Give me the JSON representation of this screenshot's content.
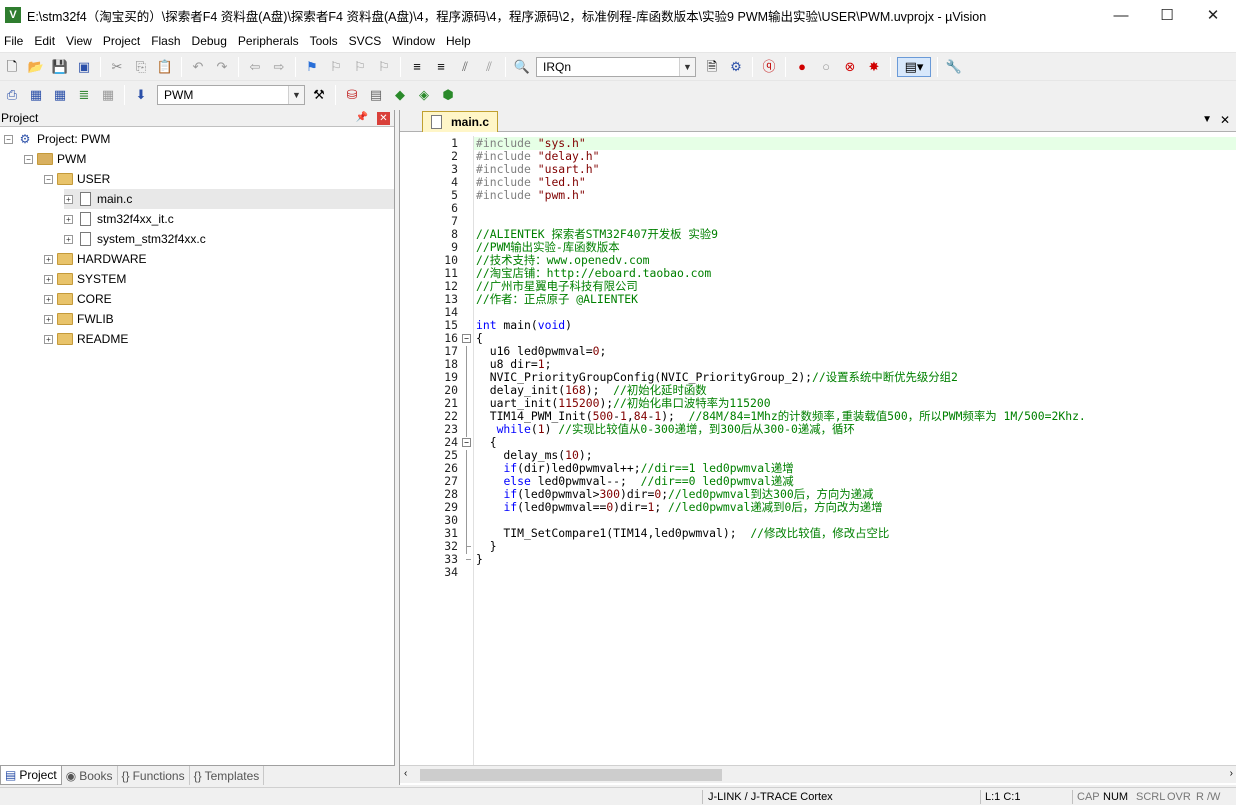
{
  "window": {
    "title": "E:\\stm32f4（淘宝买的）\\探索者F4 资料盘(A盘)\\探索者F4 资料盘(A盘)\\4，程序源码\\4，程序源码\\2，标准例程-库函数版本\\实验9 PWM输出实验\\USER\\PWM.uvprojx - µVision",
    "app_icon": "V",
    "controls": {
      "minimize": "—",
      "maximize": "☐",
      "close": "✕"
    }
  },
  "menu": [
    "File",
    "Edit",
    "View",
    "Project",
    "Flash",
    "Debug",
    "Peripherals",
    "Tools",
    "SVCS",
    "Window",
    "Help"
  ],
  "toolbar1": {
    "find_combo": "IRQn"
  },
  "toolbar2": {
    "target_combo": "PWM"
  },
  "project_pane": {
    "title": "Project",
    "pin": "📌",
    "close": "✕",
    "tree": [
      {
        "label": "Project: PWM",
        "level": 0,
        "expander": "−",
        "type": "project"
      },
      {
        "label": "PWM",
        "level": 1,
        "expander": "−",
        "type": "target"
      },
      {
        "label": "USER",
        "level": 2,
        "expander": "−",
        "type": "folder"
      },
      {
        "label": "main.c",
        "level": 3,
        "expander": "+",
        "type": "file",
        "selected": true
      },
      {
        "label": "stm32f4xx_it.c",
        "level": 3,
        "expander": "+",
        "type": "file"
      },
      {
        "label": "system_stm32f4xx.c",
        "level": 3,
        "expander": "+",
        "type": "file"
      },
      {
        "label": "HARDWARE",
        "level": 2,
        "expander": "+",
        "type": "folder"
      },
      {
        "label": "SYSTEM",
        "level": 2,
        "expander": "+",
        "type": "folder"
      },
      {
        "label": "CORE",
        "level": 2,
        "expander": "+",
        "type": "folder"
      },
      {
        "label": "FWLIB",
        "level": 2,
        "expander": "+",
        "type": "folder"
      },
      {
        "label": "README",
        "level": 2,
        "expander": "+",
        "type": "folder"
      }
    ],
    "tabs": [
      {
        "label": "Project",
        "icon": "▤",
        "active": true
      },
      {
        "label": "Books",
        "icon": "◉",
        "active": false
      },
      {
        "label": "Functions",
        "icon": "{}",
        "active": false
      },
      {
        "label": "Templates",
        "icon": "{}",
        "active": false
      }
    ]
  },
  "editor": {
    "tab": "main.c",
    "dropdown": "▼",
    "close": "✕",
    "lines": [
      [
        [
          "pp",
          "#include "
        ],
        [
          "str",
          "\"sys.h\""
        ]
      ],
      [
        [
          "pp",
          "#include "
        ],
        [
          "str",
          "\"delay.h\""
        ]
      ],
      [
        [
          "pp",
          "#include "
        ],
        [
          "str",
          "\"usart.h\""
        ]
      ],
      [
        [
          "pp",
          "#include "
        ],
        [
          "str",
          "\"led.h\""
        ]
      ],
      [
        [
          "pp",
          "#include "
        ],
        [
          "str",
          "\"pwm.h\""
        ]
      ],
      [],
      [],
      [
        [
          "cm",
          "//ALIENTEK 探索者STM32F407开发板 实验9"
        ]
      ],
      [
        [
          "cm",
          "//PWM输出实验-库函数版本"
        ]
      ],
      [
        [
          "cm",
          "//技术支持：www.openedv.com"
        ]
      ],
      [
        [
          "cm",
          "//淘宝店铺：http://eboard.taobao.com"
        ]
      ],
      [
        [
          "cm",
          "//广州市星翼电子科技有限公司"
        ]
      ],
      [
        [
          "cm",
          "//作者：正点原子 @ALIENTEK"
        ]
      ],
      [],
      [
        [
          "kw",
          "int"
        ],
        [
          "tx",
          " main("
        ],
        [
          "kw",
          "void"
        ],
        [
          "tx",
          ")"
        ]
      ],
      [
        [
          "tx",
          "{"
        ]
      ],
      [
        [
          "tx",
          "  u16 led0pwmval="
        ],
        [
          "num",
          "0"
        ],
        [
          "tx",
          ";"
        ]
      ],
      [
        [
          "tx",
          "  u8 dir="
        ],
        [
          "num",
          "1"
        ],
        [
          "tx",
          ";"
        ]
      ],
      [
        [
          "tx",
          "  NVIC_PriorityGroupConfig(NVIC_PriorityGroup_2);"
        ],
        [
          "cm",
          "//设置系统中断优先级分组2"
        ]
      ],
      [
        [
          "tx",
          "  delay_init("
        ],
        [
          "num",
          "168"
        ],
        [
          "tx",
          ");  "
        ],
        [
          "cm",
          "//初始化延时函数"
        ]
      ],
      [
        [
          "tx",
          "  uart_init("
        ],
        [
          "num",
          "115200"
        ],
        [
          "tx",
          ");"
        ],
        [
          "cm",
          "//初始化串口波特率为115200"
        ]
      ],
      [
        [
          "tx",
          "  TIM14_PWM_Init("
        ],
        [
          "num",
          "500"
        ],
        [
          "tx",
          "-"
        ],
        [
          "num",
          "1"
        ],
        [
          "tx",
          ","
        ],
        [
          "num",
          "84"
        ],
        [
          "tx",
          "-"
        ],
        [
          "num",
          "1"
        ],
        [
          "tx",
          ");  "
        ],
        [
          "cm",
          "//84M/84=1Mhz的计数频率,重装载值500，所以PWM频率为 1M/500=2Khz."
        ]
      ],
      [
        [
          "tx",
          "   "
        ],
        [
          "kw",
          "while"
        ],
        [
          "tx",
          "("
        ],
        [
          "num",
          "1"
        ],
        [
          "tx",
          ") "
        ],
        [
          "cm",
          "//实现比较值从0-300递增，到300后从300-0递减，循环"
        ]
      ],
      [
        [
          "tx",
          "  {"
        ]
      ],
      [
        [
          "tx",
          "    delay_ms("
        ],
        [
          "num",
          "10"
        ],
        [
          "tx",
          ");"
        ]
      ],
      [
        [
          "tx",
          "    "
        ],
        [
          "kw",
          "if"
        ],
        [
          "tx",
          "(dir)led0pwmval++;"
        ],
        [
          "cm",
          "//dir==1 led0pwmval递增"
        ]
      ],
      [
        [
          "tx",
          "    "
        ],
        [
          "kw",
          "else"
        ],
        [
          "tx",
          " led0pwmval--;  "
        ],
        [
          "cm",
          "//dir==0 led0pwmval递减"
        ]
      ],
      [
        [
          "tx",
          "    "
        ],
        [
          "kw",
          "if"
        ],
        [
          "tx",
          "(led0pwmval>"
        ],
        [
          "num",
          "300"
        ],
        [
          "tx",
          ")dir="
        ],
        [
          "num",
          "0"
        ],
        [
          "tx",
          ";"
        ],
        [
          "cm",
          "//led0pwmval到达300后，方向为递减"
        ]
      ],
      [
        [
          "tx",
          "    "
        ],
        [
          "kw",
          "if"
        ],
        [
          "tx",
          "(led0pwmval=="
        ],
        [
          "num",
          "0"
        ],
        [
          "tx",
          ")dir="
        ],
        [
          "num",
          "1"
        ],
        [
          "tx",
          "; "
        ],
        [
          "cm",
          "//led0pwmval递减到0后，方向改为递增"
        ]
      ],
      [],
      [
        [
          "tx",
          "    TIM_SetCompare1(TIM14,led0pwmval);  "
        ],
        [
          "cm",
          "//修改比较值，修改占空比"
        ]
      ],
      [
        [
          "tx",
          "  }"
        ]
      ],
      [
        [
          "tx",
          "}"
        ]
      ],
      []
    ],
    "folds": [
      16,
      24
    ]
  },
  "status": {
    "debugger": "J-LINK / J-TRACE Cortex",
    "position": "L:1 C:1",
    "cap": "CAP",
    "num": "NUM",
    "scrl": "SCRL",
    "ovr": "OVR",
    "rw": "R /W"
  },
  "colors": {
    "keyword": "#0000ff",
    "comment": "#008000",
    "string": "#800000",
    "preprocessor": "#808080",
    "current_line": "#e6ffe6"
  }
}
